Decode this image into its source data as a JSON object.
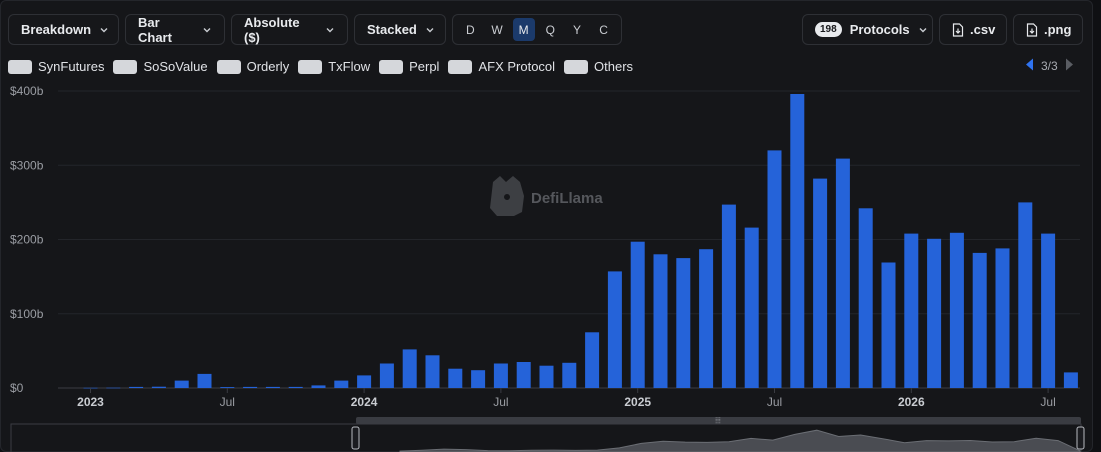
{
  "toolbar": {
    "breakdown_label": "Breakdown",
    "chart_type_label": "Bar Chart",
    "value_mode_label": "Absolute ($)",
    "stack_label": "Stacked",
    "granularity": [
      "D",
      "W",
      "M",
      "Q",
      "Y",
      "C"
    ],
    "granularity_selected": "M",
    "protocols_count": "198",
    "protocols_label": "Protocols",
    "csv_label": ".csv",
    "png_label": ".png"
  },
  "legend": {
    "items": [
      "SynFutures",
      "SoSoValue",
      "Orderly",
      "TxFlow",
      "Perpl",
      "AFX Protocol",
      "Others"
    ],
    "swatch_color": "#d5d7db",
    "page_indicator": "3/3"
  },
  "watermark": "DefiLlama",
  "colors": {
    "bar": "#2563d9",
    "background": "#151619",
    "grid": "#23252a",
    "axis_text": "#9a9da3"
  },
  "chart_data": {
    "type": "bar",
    "stacked": true,
    "y_ticks": [
      "$0",
      "$100b",
      "$200b",
      "$300b",
      "$400b"
    ],
    "ylim": [
      0,
      400
    ],
    "y_unit": "$b",
    "x_tick_labels": [
      {
        "label": "2023",
        "month": "2023-01",
        "bold": true
      },
      {
        "label": "Jul",
        "month": "2023-07",
        "bold": false
      },
      {
        "label": "2024",
        "month": "2024-01",
        "bold": true
      },
      {
        "label": "Jul",
        "month": "2024-07",
        "bold": false
      },
      {
        "label": "2025",
        "month": "2025-01",
        "bold": true
      },
      {
        "label": "Jul",
        "month": "2025-07",
        "bold": false
      },
      {
        "label": "2026",
        "month": "2026-01",
        "bold": true
      },
      {
        "label": "Jul",
        "month": "2026-07",
        "bold": false
      }
    ],
    "categories": [
      "2023-01",
      "2023-02",
      "2023-03",
      "2023-04",
      "2023-05",
      "2023-06",
      "2023-07",
      "2023-08",
      "2023-09",
      "2023-10",
      "2023-11",
      "2023-12",
      "2024-01",
      "2024-02",
      "2024-03",
      "2024-04",
      "2024-05",
      "2024-06",
      "2024-07",
      "2024-08",
      "2024-09",
      "2024-10",
      "2024-11",
      "2024-12",
      "2025-01",
      "2025-02",
      "2025-03",
      "2025-04",
      "2025-05",
      "2025-06",
      "2025-07",
      "2025-08",
      "2025-09",
      "2025-10",
      "2025-11",
      "2025-12",
      "2026-01",
      "2026-02",
      "2026-03",
      "2026-04",
      "2026-05",
      "2026-06",
      "2026-07",
      "2026-08"
    ],
    "values": [
      0.3,
      0.4,
      1.5,
      1.8,
      10,
      19,
      1.2,
      1.5,
      1.5,
      1.5,
      3.5,
      10,
      17,
      33,
      52,
      44,
      26,
      24,
      33,
      35,
      30,
      34,
      75,
      157,
      197,
      180,
      175,
      187,
      247,
      216,
      320,
      396,
      282,
      309,
      242,
      169,
      208,
      201,
      209,
      182,
      188,
      250,
      208,
      21
    ],
    "grid": true
  }
}
